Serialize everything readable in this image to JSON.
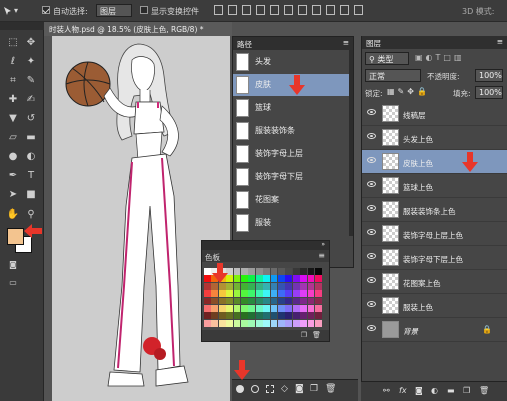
{
  "options_bar": {
    "auto_select_label": "自动选择:",
    "auto_select_value": "图层",
    "show_transform_label": "显示变换控件",
    "mode_label": "3D 模式:"
  },
  "document": {
    "tab_title": "时装人物.psd @ 18.5% (皮肤上色, RGB/8) *"
  },
  "paths_panel": {
    "title": "路径",
    "items": [
      {
        "label": "头发",
        "selected": false
      },
      {
        "label": "皮肤",
        "selected": true
      },
      {
        "label": "篮球",
        "selected": false
      },
      {
        "label": "服装装饰条",
        "selected": false
      },
      {
        "label": "装饰字母上层",
        "selected": false
      },
      {
        "label": "装饰字母下层",
        "selected": false
      },
      {
        "label": "花图案",
        "selected": false
      },
      {
        "label": "服装",
        "selected": false
      }
    ]
  },
  "swatches_panel": {
    "title": "色板"
  },
  "layers_panel": {
    "title": "图层",
    "filter_label": "类型",
    "blend_mode": "正常",
    "opacity_label": "不透明度:",
    "opacity_value": "100%",
    "lock_label": "锁定:",
    "fill_label": "填充:",
    "fill_value": "100%",
    "items": [
      {
        "label": "线稿层",
        "selected": false
      },
      {
        "label": "头发上色",
        "selected": false
      },
      {
        "label": "皮肤上色",
        "selected": true
      },
      {
        "label": "篮球上色",
        "selected": false
      },
      {
        "label": "服装装饰条上色",
        "selected": false
      },
      {
        "label": "装饰字母上层上色",
        "selected": false
      },
      {
        "label": "装饰字母下层上色",
        "selected": false
      },
      {
        "label": "花图案上色",
        "selected": false
      },
      {
        "label": "服装上色",
        "selected": false
      },
      {
        "label": "背景",
        "selected": false
      }
    ]
  },
  "colors": {
    "foreground": "#f3c48f",
    "background": "#ffffff",
    "selection": "#7e97bd",
    "arrow": "#e8362a"
  },
  "icons": [
    "move-icon",
    "marquee-icon",
    "lasso-icon",
    "magic-wand-icon",
    "crop-icon",
    "eyedropper-icon",
    "healing-icon",
    "brush-icon",
    "stamp-icon",
    "history-brush-icon",
    "eraser-icon",
    "gradient-icon",
    "blur-icon",
    "dodge-icon",
    "pen-icon",
    "type-icon",
    "path-select-icon",
    "shape-icon",
    "hand-icon",
    "zoom-icon",
    "eye-icon",
    "lock-icon"
  ]
}
